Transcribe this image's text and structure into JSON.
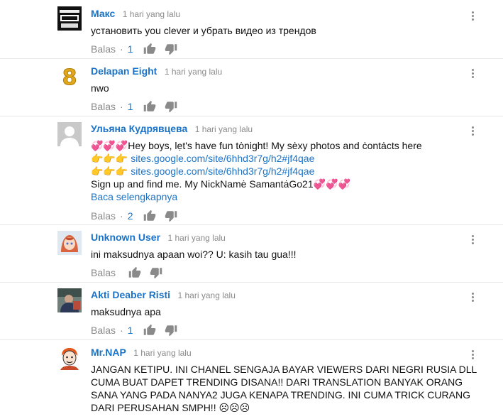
{
  "comments": [
    {
      "author": "Макс",
      "time": "1 hari yang lalu",
      "lines": [
        "установить you clever  и убрать  видео из трендов"
      ],
      "reply_label": "Balas",
      "dot": "·",
      "likes": "1",
      "avatar_icon": "obey-logo-avatar"
    },
    {
      "author": "Delapan Eight",
      "time": "1 hari yang lalu",
      "lines": [
        "nwo"
      ],
      "reply_label": "Balas",
      "dot": "·",
      "likes": "1",
      "avatar_icon": "number-eight-avatar"
    },
    {
      "author": "Ульяна Кудрявцева",
      "time": "1 hari yang lalu",
      "lines": [
        "💞💞💞Hey boys, lẹt's have fun tȯnight! My sėxy photos and ċontȧcts here",
        "👉👉👉 ",
        "👉👉👉 ",
        "Sign up and find me. My NickNamė SamantȧGo21💞💞💞"
      ],
      "links": [
        "sites.google.com/site/6hhd3r7g/h2#jf4qae",
        "sites.google.com/site/6hhd3r7g/h2#jf4qae"
      ],
      "read_more": "Baca selengkapnya",
      "reply_label": "Balas",
      "dot": "·",
      "likes": "2",
      "avatar_icon": "default-user-avatar"
    },
    {
      "author": "Unknown User",
      "time": "1 hari yang lalu",
      "lines": [
        "ini maksudnya apaan woi?? U: kasih tau gua!!!"
      ],
      "reply_label": "Balas",
      "avatar_icon": "anime-girl-avatar"
    },
    {
      "author": "Akti Deaber Risti",
      "time": "1 hari yang lalu",
      "lines": [
        "maksudnya apa"
      ],
      "reply_label": "Balas",
      "dot": "·",
      "likes": "1",
      "avatar_icon": "photo-avatar"
    },
    {
      "author": "Mr.NAP",
      "time": "1 hari yang lalu",
      "lines": [
        "JANGAN KETIPU. INI CHANEL SENGAJA BAYAR VIEWERS DARI NEGRI RUSIA DLL",
        "CUMA BUAT DAPET TRENDING DISANA!! DARI TRANSLATION BANYAK ORANG",
        "SANA YANG PADA NANYA2 JUGA KENAPA TRENDING. INI CUMA TRICK CURANG",
        "DARI PERUSAHAN SMPH!! ☹☹☹"
      ],
      "avatar_icon": "cartoon-man-avatar"
    }
  ],
  "colors": {
    "link": "#1a73c8",
    "meta": "#8a8a8a",
    "text": "#111111",
    "separator": "#e8e8e8"
  }
}
